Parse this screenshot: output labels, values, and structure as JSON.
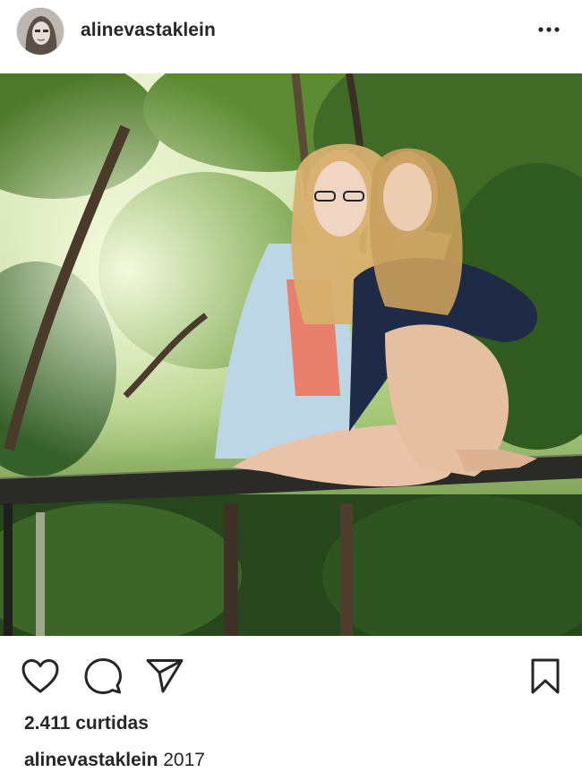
{
  "post": {
    "username": "alinevastaklein",
    "more_icon": "more-options-icon",
    "photo_alt": "",
    "likes_text": "2.411 curtidas",
    "caption_user": "alinevastaklein",
    "caption_text": " 2017"
  },
  "actions": {
    "like_icon": "heart-icon",
    "comment_icon": "comment-icon",
    "share_icon": "share-icon",
    "save_icon": "bookmark-icon"
  },
  "colors": {
    "text": "#262626",
    "background": "#ffffff"
  }
}
